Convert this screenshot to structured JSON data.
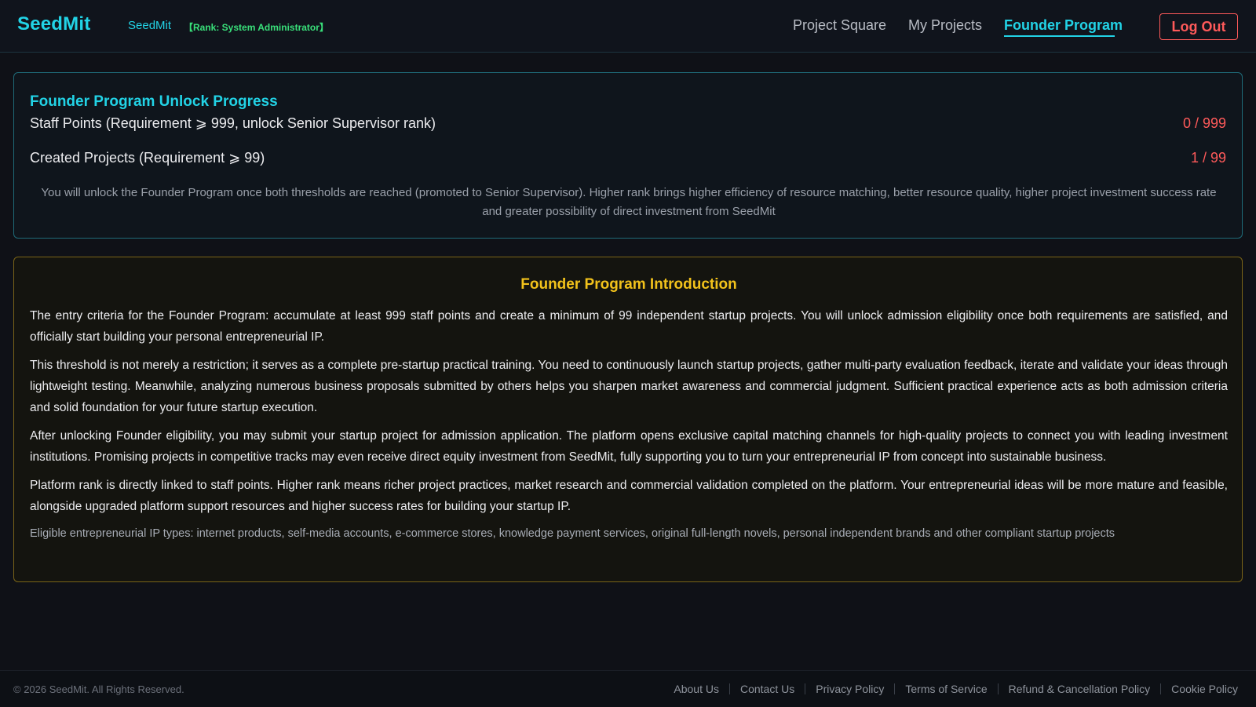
{
  "header": {
    "logo": "SeedMit",
    "user_name": "SeedMit",
    "user_rank": "【Rank: System Administrator】",
    "nav": [
      "Project Square",
      "My Projects",
      "Founder Program"
    ],
    "active_nav": "Founder Program",
    "logout_label": "Log Out"
  },
  "progress": {
    "title": "Founder Program Unlock Progress",
    "requirements": [
      {
        "label": "Staff Points (Requirement ⩾ 999, unlock Senior Supervisor rank)",
        "value": "0 / 999",
        "current": 0,
        "target": 999
      },
      {
        "label": "Created Projects (Requirement ⩾ 99)",
        "value": "1 / 99",
        "current": 1,
        "target": 99
      }
    ],
    "note": "You will unlock the Founder Program once both thresholds are reached (promoted to Senior Supervisor). Higher rank brings higher efficiency of resource matching, better resource quality, higher project investment success rate and greater possibility of direct investment from SeedMit"
  },
  "intro": {
    "title": "Founder Program Introduction",
    "paragraphs": [
      "The entry criteria for the Founder Program: accumulate at least 999 staff points and create a minimum of 99 independent startup projects. You will unlock admission eligibility once both requirements are satisfied, and officially start building your personal entrepreneurial IP.",
      "This threshold is not merely a restriction; it serves as a complete pre-startup practical training. You need to continuously launch startup projects, gather multi-party evaluation feedback, iterate and validate your ideas through lightweight testing. Meanwhile, analyzing numerous business proposals submitted by others helps you sharpen market awareness and commercial judgment. Sufficient practical experience acts as both admission criteria and solid foundation for your future startup execution.",
      "After unlocking Founder eligibility, you may submit your startup project for admission application. The platform opens exclusive capital matching channels for high-quality projects to connect you with leading investment institutions. Promising projects in competitive tracks may even receive direct equity investment from SeedMit, fully supporting you to turn your entrepreneurial IP from concept into sustainable business.",
      "Platform rank is directly linked to staff points. Higher rank means richer project practices, market research and commercial validation completed on the platform. Your entrepreneurial ideas will be more mature and feasible, alongside upgraded platform support resources and higher success rates for building your startup IP."
    ],
    "eligible": "Eligible entrepreneurial IP types: internet products, self-media accounts, e-commerce stores, knowledge payment services, original full-length novels, personal independent brands and other compliant startup projects"
  },
  "footer": {
    "copyright": "© 2026 SeedMit. All Rights Reserved.",
    "links": [
      "About Us",
      "Contact Us",
      "Privacy Policy",
      "Terms of Service",
      "Refund & Cancellation Policy",
      "Cookie Policy"
    ]
  },
  "colors": {
    "accent": "#22d3e6",
    "rank_green": "#39e07a",
    "danger": "#ff5a5a",
    "gold": "#f2c21b"
  }
}
